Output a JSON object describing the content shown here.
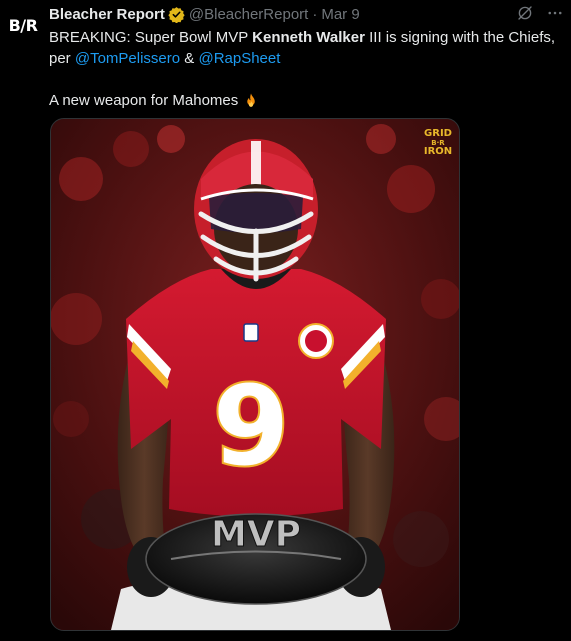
{
  "account": {
    "avatar_text": "B/R",
    "name": "Bleacher Report",
    "handle": "@BleacherReport",
    "separator": "·",
    "date": "Mar 9"
  },
  "tweet": {
    "line1_prefix": "BREAKING: Super Bowl MVP ",
    "line1_bold": "Kenneth Walker",
    "line1_suffix": " III is signing with the Chiefs,",
    "line2_prefix": "per ",
    "mention1": "@TomPelissero",
    "amp": " & ",
    "mention2": "@RapSheet",
    "line3": "A new weapon for Mahomes",
    "emoji_name": "fire-icon"
  },
  "media": {
    "brand_top": "GRID",
    "brand_mid": "B·R",
    "brand_bottom": "IRON",
    "jersey_number": "9",
    "ball_text": "MVP",
    "colors": {
      "jersey": "#c8102e",
      "helmet": "#c61f2b",
      "number": "#ffffff",
      "number_outline": "#f2b12c",
      "background_crowd": "#5a1414"
    }
  },
  "icons": {
    "verified": "verified-badge-icon",
    "grok": "grok-icon",
    "more": "more-icon"
  },
  "colors": {
    "background": "#000000",
    "text": "#e7e9ea",
    "muted": "#71767b",
    "link": "#1d9bf0",
    "verified_gold": "#e2b719"
  }
}
